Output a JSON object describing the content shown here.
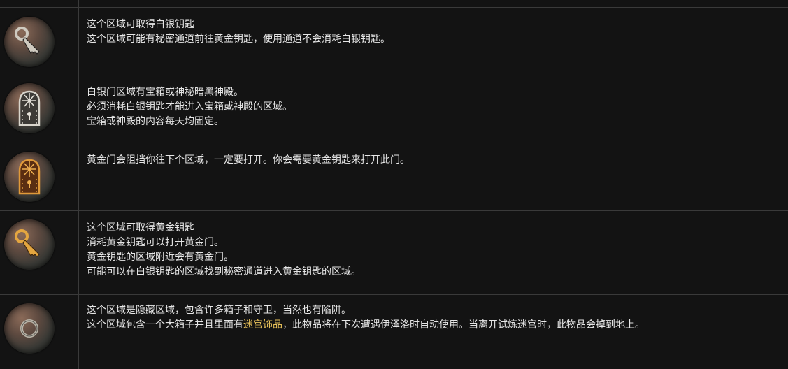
{
  "colors": {
    "background": "#131313",
    "border": "#3a3a3a",
    "text": "#e6e6e6",
    "highlight": "#e9c25a"
  },
  "rows": [
    {
      "icon": "silver-key-icon",
      "lines": [
        "这个区域可取得白银钥匙",
        "这个区域可能有秘密通道前往黄金钥匙，使用通道不会消耗白银钥匙。"
      ]
    },
    {
      "icon": "silver-door-icon",
      "lines": [
        "白银门区域有宝箱或神秘暗黑神殿。",
        "必须消耗白银钥匙才能进入宝箱或神殿的区域。",
        "宝箱或神殿的内容每天均固定。"
      ]
    },
    {
      "icon": "golden-door-icon",
      "lines": [
        "黄金门会阻挡你往下个区域，一定要打开。你会需要黄金钥匙来打开此门。"
      ]
    },
    {
      "icon": "golden-key-icon",
      "lines": [
        "这个区域可取得黄金钥匙",
        "消耗黄金钥匙可以打开黄金门。",
        "黄金钥匙的区域附近会有黄金门。",
        "可能可以在白银钥匙的区域找到秘密通道进入黄金钥匙的区域。"
      ]
    },
    {
      "icon": "hidden-area-ring-icon",
      "line1": "这个区域是隐藏区域，包含许多箱子和守卫，当然也有陷阱。",
      "line2_before": "这个区域包含一个大箱子并且里面有",
      "line2_highlight": "迷宫饰品",
      "line2_after": "，此物品将在下次遭遇伊泽洛时自动使用。当离开试炼迷宫时，此物品会掉到地上。"
    }
  ]
}
